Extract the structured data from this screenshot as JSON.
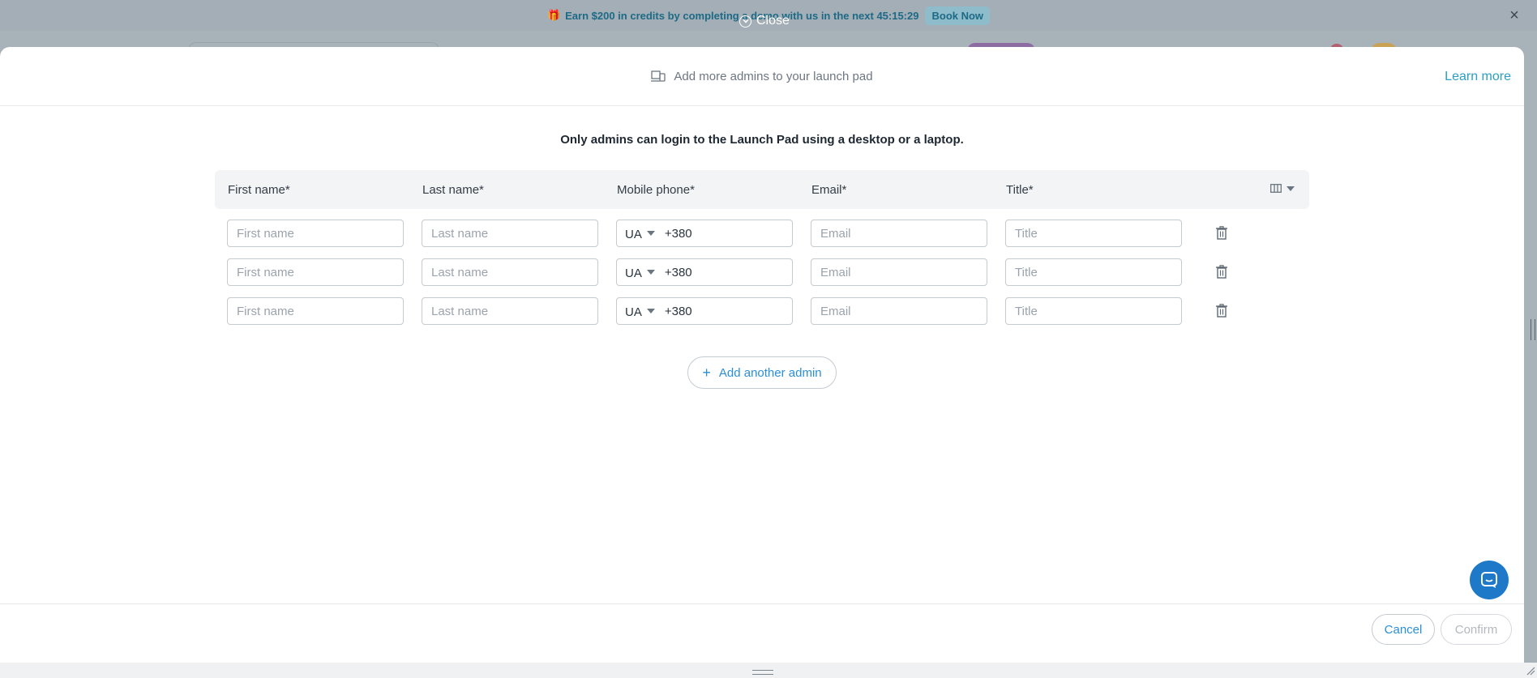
{
  "banner": {
    "text": "Earn $200 in credits by completing a demo with us in the next 45:15:29",
    "book_label": "Book Now"
  },
  "overlay": {
    "close_label": "Close"
  },
  "modal": {
    "header_title": "Add more admins to your launch pad",
    "learn_more": "Learn more",
    "notice": "Only admins can login to the Launch Pad using a desktop or a laptop.",
    "columns": [
      "First name*",
      "Last name*",
      "Mobile phone*",
      "Email*",
      "Title*"
    ],
    "placeholders": {
      "first_name": "First name",
      "last_name": "Last name",
      "email": "Email",
      "title": "Title"
    },
    "rows": [
      {
        "country": "UA",
        "phone_prefix": "+380"
      },
      {
        "country": "UA",
        "phone_prefix": "+380"
      },
      {
        "country": "UA",
        "phone_prefix": "+380"
      }
    ],
    "add_admin_label": "Add another admin"
  },
  "footer": {
    "cancel_label": "Cancel",
    "confirm_label": "Confirm"
  },
  "colors": {
    "accent": "#2a8fd6",
    "link": "#2a9fc4",
    "chat": "#1f79c9",
    "banner_text": "#1d6a86"
  },
  "icons": [
    "gift-icon",
    "close-icon",
    "chevron-circle-icon",
    "devices-icon",
    "columns-icon",
    "caret-down-icon",
    "trash-icon",
    "plus-icon",
    "chat-icon"
  ]
}
